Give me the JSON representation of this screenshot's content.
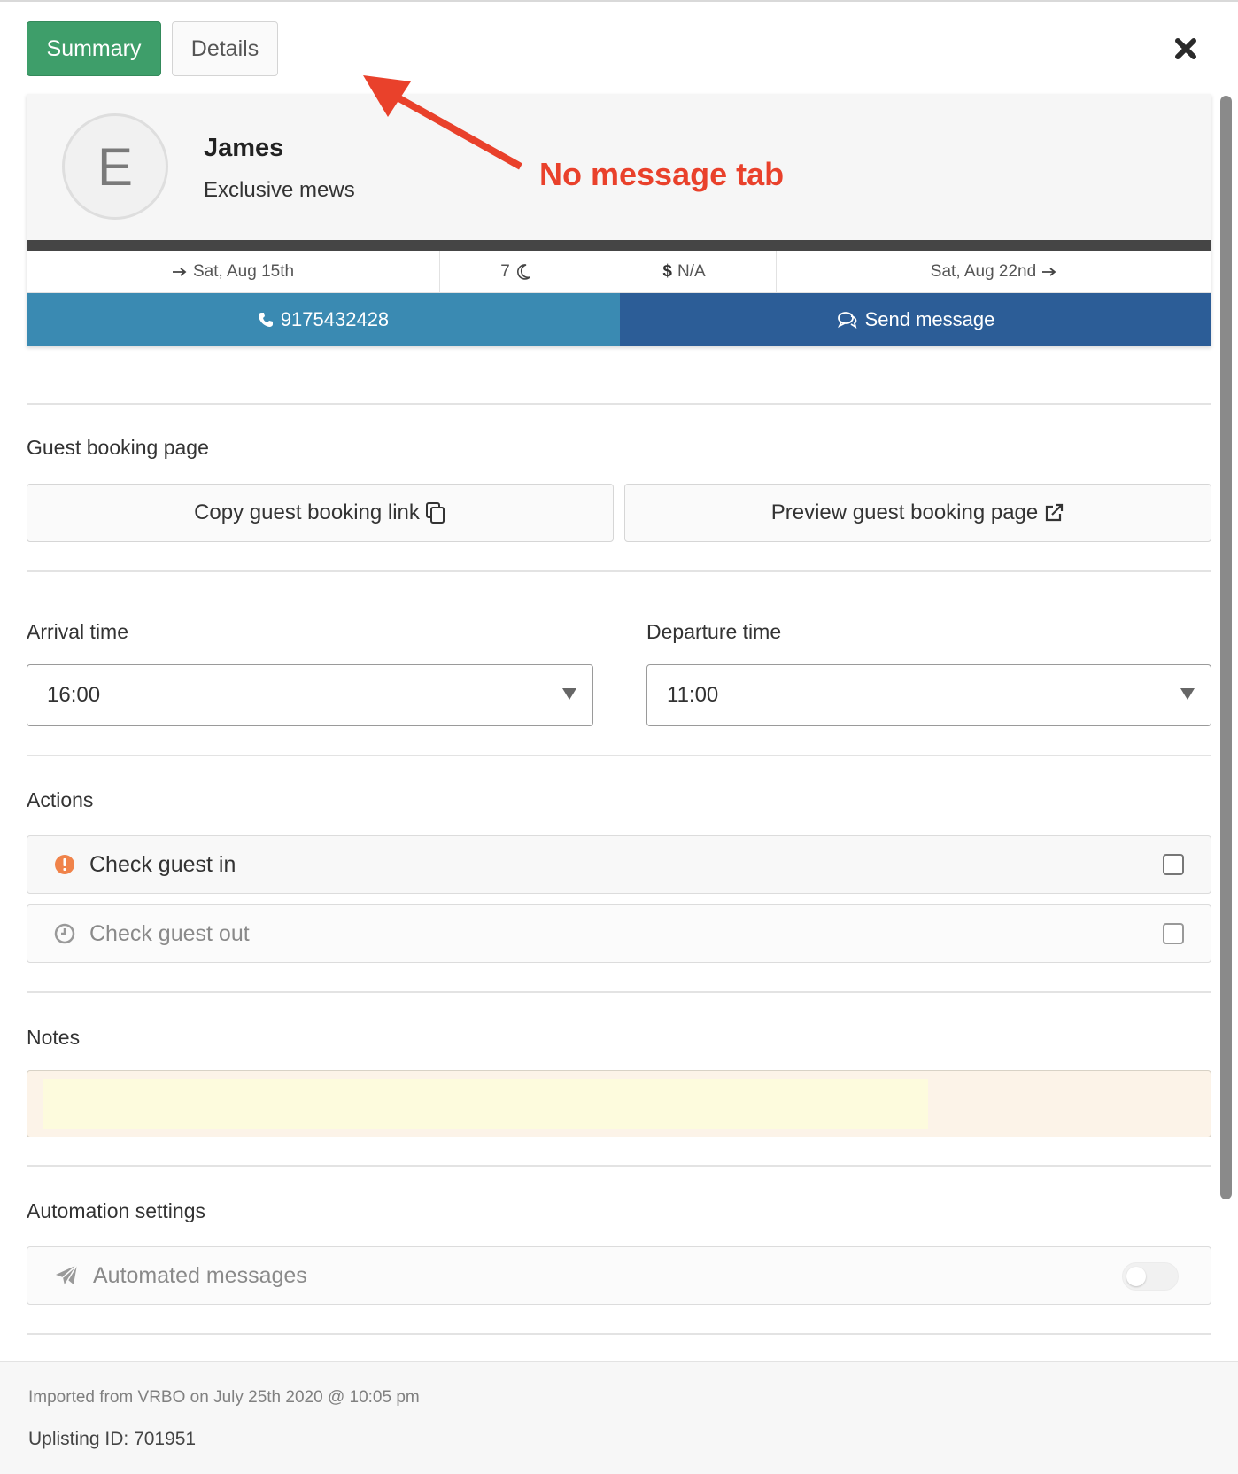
{
  "tabs": {
    "summary_label": "Summary",
    "details_label": "Details"
  },
  "guest": {
    "avatar_initial": "E",
    "name": "James",
    "property": "Exclusive mews"
  },
  "stay": {
    "arrival": "Sat, Aug 15th",
    "nights": "7",
    "price": "N/A",
    "departure": "Sat, Aug 22nd"
  },
  "contact": {
    "phone": "9175432428",
    "send_message_label": "Send message"
  },
  "annotation": {
    "text": "No message tab",
    "color": "#e9412b"
  },
  "guest_booking": {
    "section_label": "Guest booking page",
    "copy_link_label": "Copy guest booking link",
    "preview_label": "Preview guest booking page"
  },
  "times": {
    "arrival_label": "Arrival time",
    "arrival_value": "16:00",
    "departure_label": "Departure time",
    "departure_value": "11:00"
  },
  "actions": {
    "section_label": "Actions",
    "check_in_label": "Check guest in",
    "check_out_label": "Check guest out",
    "check_in_checked": false,
    "check_out_checked": false
  },
  "notes": {
    "section_label": "Notes",
    "value": ""
  },
  "automation": {
    "section_label": "Automation settings",
    "automated_messages_label": "Automated messages",
    "enabled": false
  },
  "footer": {
    "import_text": "Imported from VRBO on July 25th 2020 @ 10:05 pm",
    "uplisting_id": "Uplisting ID: 701951"
  },
  "colors": {
    "summary_tab": "#3e9e6a",
    "call_button": "#3a8ab2",
    "message_button": "#2c5d97",
    "header_bar": "#454545",
    "check_in_warning": "#f0834a"
  },
  "icons": {
    "close": "close-icon",
    "arrive": "arrow-right-icon",
    "nights": "moon-icon",
    "price": "dollar-icon",
    "phone": "phone-icon",
    "message": "chat-icon",
    "copy": "copy-icon",
    "external": "external-link-icon",
    "check_in": "warning-circle-icon",
    "check_out": "clock-icon",
    "automation": "paper-plane-icon"
  }
}
